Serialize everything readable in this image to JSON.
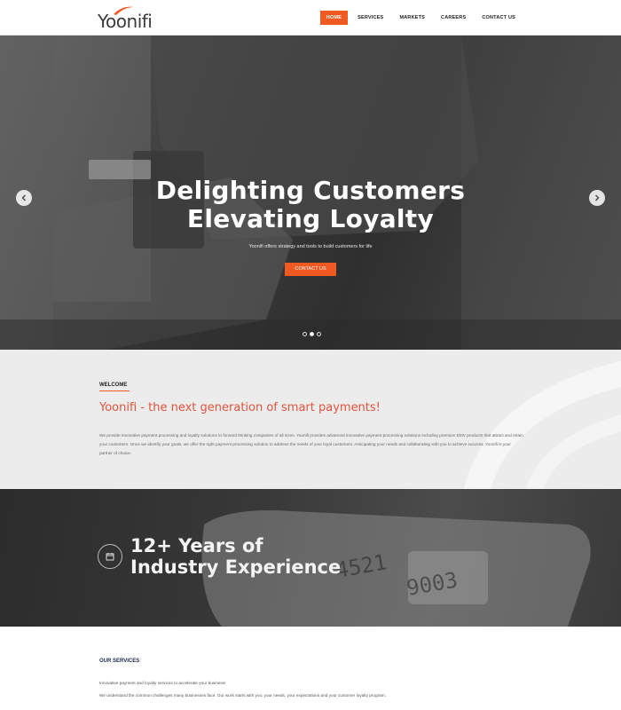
{
  "header": {
    "logo_text": "Yoonifi",
    "nav": [
      "HOME",
      "SERVICES",
      "MARKETS",
      "CAREERS",
      "CONTACT US"
    ],
    "active_nav": "HOME"
  },
  "hero": {
    "title_line1": "Delighting Customers",
    "title_line2": "Elevating Loyalty",
    "subtitle": "Yoonifi offers strategy and tools to build customers for life",
    "cta_label": "CONTACT US",
    "slides": 3,
    "active_slide": 2
  },
  "welcome": {
    "label": "WELCOME",
    "heading": "Yoonifi - the next generation of smart payments!",
    "body": "We provide innovative payment processing and loyalty solutions to forward thinking companies of all sizes. Yoonifi provides advanced innovative payment processing solutions including premium EMV products that attract and retain your customers. Once we identify your goals, we offer the right payment processing solution to address the needs of your loyal customers. Anticipating your needs and collaborating with you to achieve success. Yoonifi is your partner of choice."
  },
  "experience": {
    "title_line1": "12+ Years of",
    "title_line2": "Industry Experience"
  },
  "services": {
    "label": "OUR SERVICES",
    "line1": "Innovative payment and loyalty services to accelerate your business!",
    "line2": "We understand the common challenges many businesses face. Our work starts with you: your needs, your expectations and your customer loyalty program."
  },
  "colors": {
    "accent": "#f05a22",
    "heading_red": "#e0533d",
    "navy": "#1e2a4a"
  },
  "icons": [
    "chevron-left-icon",
    "chevron-right-icon",
    "calendar-icon",
    "logo-swoosh-icon"
  ]
}
